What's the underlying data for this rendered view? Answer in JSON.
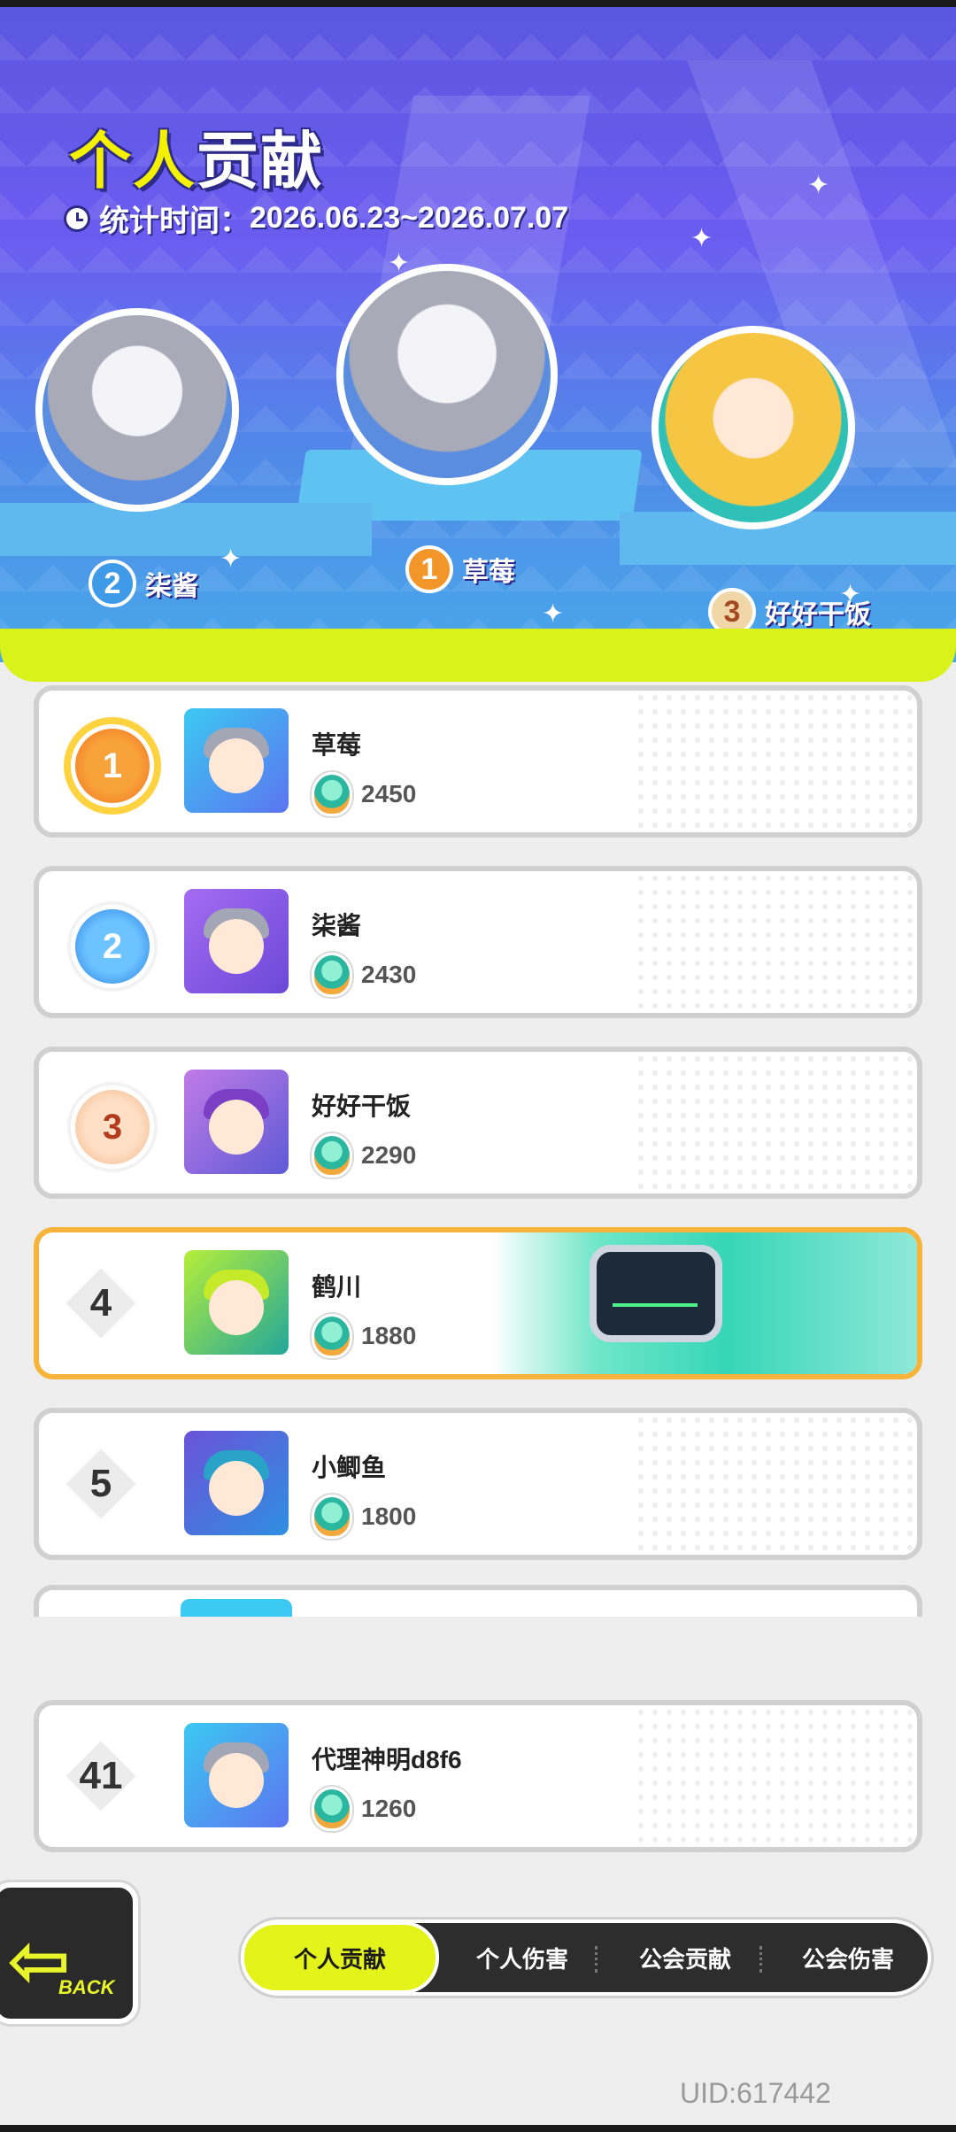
{
  "banner": {
    "title_part1": "个人",
    "title_part2": "贡献",
    "stat_label": "统计时间：",
    "stat_range": "2026.06.23~2026.07.07"
  },
  "podium": [
    {
      "rank": "2",
      "name": "柒酱"
    },
    {
      "rank": "1",
      "name": "草莓"
    },
    {
      "rank": "3",
      "name": "好好干饭"
    }
  ],
  "ranking": [
    {
      "rank": "1",
      "name": "草莓",
      "score": "2450"
    },
    {
      "rank": "2",
      "name": "柒酱",
      "score": "2430"
    },
    {
      "rank": "3",
      "name": "好好干饭",
      "score": "2290"
    },
    {
      "rank": "4",
      "name": "鹤川",
      "score": "1880"
    },
    {
      "rank": "5",
      "name": "小鲫鱼",
      "score": "1800"
    }
  ],
  "self_row": {
    "rank": "41",
    "name": "代理神明d8f6",
    "score": "1260"
  },
  "back_label": "BACK",
  "tabs": [
    {
      "label": "个人贡献",
      "active": true
    },
    {
      "label": "个人伤害",
      "active": false
    },
    {
      "label": "公会贡献",
      "active": false
    },
    {
      "label": "公会伤害",
      "active": false
    }
  ],
  "uid": "UID:617442",
  "colors": {
    "accent": "#e4f31a",
    "highlight_border": "#f7b43a",
    "banner": "#5b57e0"
  }
}
